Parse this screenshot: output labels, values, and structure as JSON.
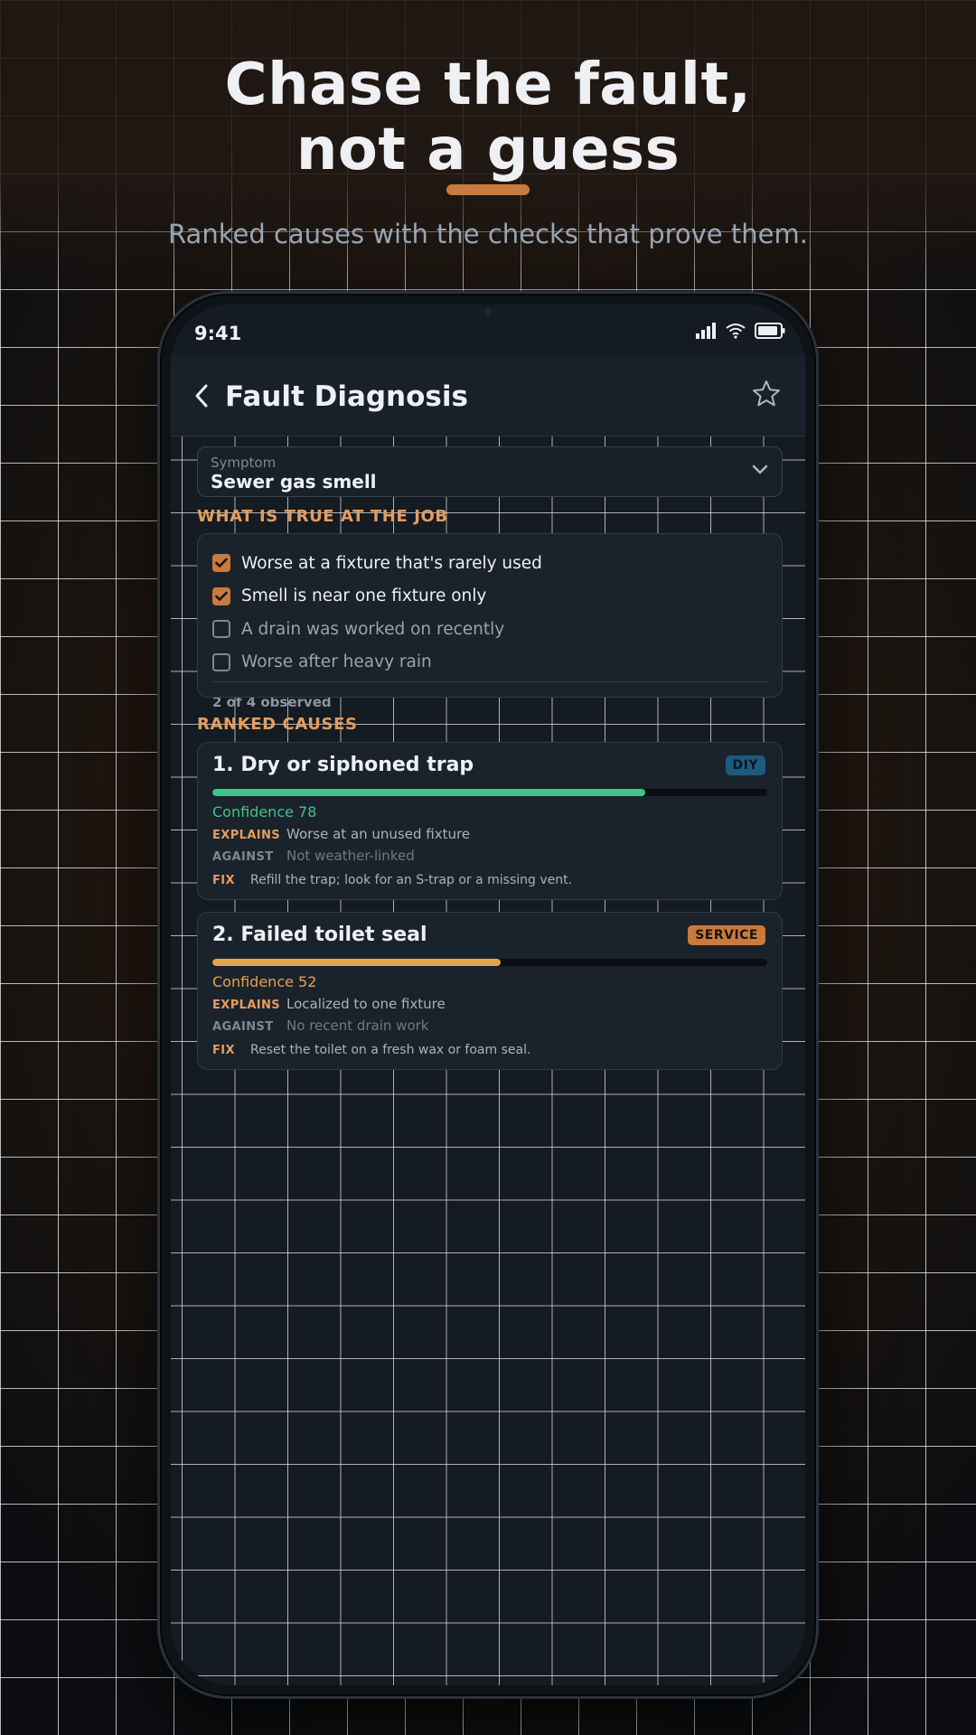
{
  "hero": {
    "title_line1": "Chase the fault,",
    "title_line2": "not a guess",
    "subtitle": "Ranked causes with the checks that prove them."
  },
  "status_bar": {
    "time": "9:41"
  },
  "app_bar": {
    "title": "Fault Diagnosis"
  },
  "symptom": {
    "label": "Symptom",
    "value": "Sewer gas smell"
  },
  "observations": {
    "section_title": "WHAT IS TRUE AT THE JOB",
    "items": [
      {
        "label": "Worse at a fixture that's rarely used",
        "checked": true
      },
      {
        "label": "Smell is near one fixture only",
        "checked": true
      },
      {
        "label": "A drain was worked on recently",
        "checked": false
      },
      {
        "label": "Worse after heavy rain",
        "checked": false
      }
    ],
    "summary": "2 of 4 observed"
  },
  "causes": {
    "section_title": "RANKED CAUSES",
    "items": [
      {
        "title": "1. Dry or siphoned trap",
        "badge": "DIY",
        "confidence_label": "Confidence 78",
        "confidence": 78,
        "bar_color": "#3fc48a",
        "explains_label": "EXPLAINS",
        "explains": "Worse at an unused fixture",
        "against_label": "AGAINST",
        "against": "Not weather-linked",
        "fix_label": "FIX",
        "fix": "Refill the trap; look for an S-trap or a missing vent."
      },
      {
        "title": "2. Failed toilet seal",
        "badge": "SERVICE",
        "confidence_label": "Confidence 52",
        "confidence": 52,
        "bar_color": "#e5a24c",
        "explains_label": "EXPLAINS",
        "explains": "Localized to one fixture",
        "against_label": "AGAINST",
        "against": "No recent drain work",
        "fix_label": "FIX",
        "fix": "Reset the toilet on a fresh wax or foam seal."
      }
    ]
  },
  "colors": {
    "accent": "#c97a3e",
    "section": "#e59c5d",
    "diy_badge": "#1d5b7e",
    "service_badge": "#c97a3e"
  },
  "icons": {
    "back": "chevron-left-icon",
    "favorite": "star-icon",
    "dropdown": "chevron-down-icon",
    "signal": "signal-icon",
    "wifi": "wifi-icon",
    "battery": "battery-icon"
  }
}
